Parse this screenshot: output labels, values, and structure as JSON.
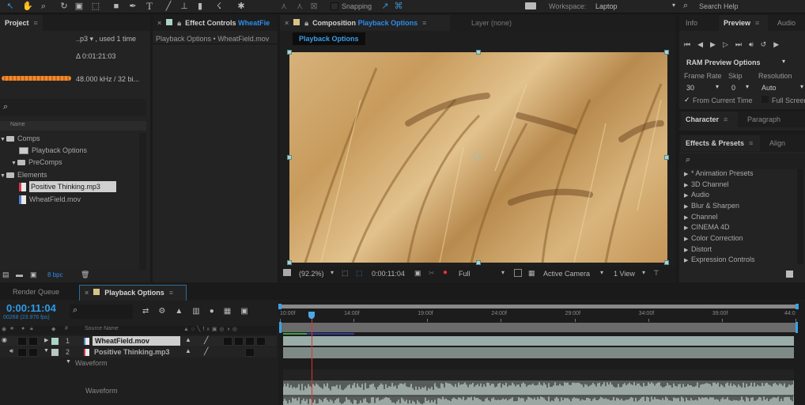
{
  "toolbar": {
    "tools": [
      "selection-tool",
      "hand-tool",
      "zoom-tool",
      "rotate-tool",
      "camera-tool",
      "pan-behind-tool",
      "rectangle-tool",
      "pen-tool",
      "type-tool",
      "brush-tool",
      "clone-stamp-tool",
      "eraser-tool",
      "roto-brush-tool",
      "puppet-pin-tool"
    ],
    "snapping_label": "Snapping",
    "workspace_label": "Workspace:",
    "workspace_value": "Laptop",
    "search_placeholder": "Search Help"
  },
  "project": {
    "tab": "Project",
    "info_line1": "..p3 ▾ , used 1 time",
    "info_line2": "Δ 0:01:21:03",
    "info_line3": "48.000 kHz / 32 bi...",
    "search_placeholder": "",
    "column_name": "Name",
    "items": [
      {
        "label": "Comps",
        "type": "folder",
        "depth": 0,
        "expanded": true
      },
      {
        "label": "Playback Options",
        "type": "comp",
        "depth": 1
      },
      {
        "label": "PreComps",
        "type": "folder",
        "depth": 1,
        "expanded": true
      },
      {
        "label": "Elements",
        "type": "folder",
        "depth": 0,
        "expanded": true
      },
      {
        "label": "Positive Thinking.mp3",
        "type": "audio",
        "depth": 1,
        "selected": true
      },
      {
        "label": "WheatField.mov",
        "type": "video",
        "depth": 1
      }
    ],
    "bpc": "8 bpc"
  },
  "effect_controls": {
    "tab_prefix": "Effect Controls",
    "tab_item": "WheatFie",
    "breadcrumb": "Playback Options • WheatField.mov"
  },
  "composition": {
    "tab_prefix": "Composition",
    "tab_item": "Playback Options",
    "layer_tab": "Layer (none)",
    "comp_chip": "Playback Options",
    "footer": {
      "zoom": "(92.2%)",
      "timecode": "0:00:11:04",
      "resolution": "Full",
      "camera": "Active Camera",
      "views": "1 View"
    }
  },
  "right": {
    "tabs": [
      "Info",
      "Preview",
      "Audio"
    ],
    "active_tab": "Preview",
    "ram_preview": "RAM Preview Options",
    "frame_rate_label": "Frame Rate",
    "skip_label": "Skip",
    "resolution_label": "Resolution",
    "frame_rate": "30",
    "skip": "0",
    "resolution": "Auto",
    "from_current_time": "From Current Time",
    "full_screen": "Full Screen",
    "char_tabs": [
      "Character",
      "Paragraph"
    ],
    "fx_tabs": [
      "Effects & Presets",
      "Align"
    ],
    "fx_items": [
      "* Animation Presets",
      "3D Channel",
      "Audio",
      "Blur & Sharpen",
      "Channel",
      "CINEMA 4D",
      "Color Correction",
      "Distort",
      "Expression Controls"
    ]
  },
  "timeline": {
    "render_queue": "Render Queue",
    "comp_tab": "Playback Options",
    "timecode": "0:00:11:04",
    "frames": "00268 (23.976 fps)",
    "col_source": "Source Name",
    "col_num": "#",
    "layers": [
      {
        "num": "1",
        "name": "WheatField.mov",
        "type": "video",
        "expanded": false
      },
      {
        "num": "2",
        "name": "Positive Thinking.mp3",
        "type": "audio",
        "expanded": true
      }
    ],
    "waveform_group": "Waveform",
    "waveform_label": "Waveform",
    "ruler_ticks": [
      "10:00f",
      "14:00f",
      "19:00f",
      "24:00f",
      "29:00f",
      "34:00f",
      "39:00f",
      "44:0"
    ],
    "playhead_fraction": 0.055
  }
}
